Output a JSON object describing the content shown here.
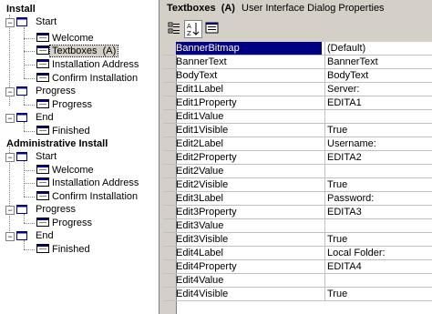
{
  "tree": {
    "install": {
      "label": "Install",
      "start": {
        "label": "Start",
        "items": [
          "Welcome",
          "Textboxes  (A)",
          "Installation Address",
          "Confirm Installation"
        ]
      },
      "progress": {
        "label": "Progress",
        "items": [
          "Progress"
        ]
      },
      "end": {
        "label": "End",
        "items": [
          "Finished"
        ]
      }
    },
    "admin": {
      "label": "Administrative Install",
      "start": {
        "label": "Start",
        "items": [
          "Welcome",
          "Installation Address",
          "Confirm Installation"
        ]
      },
      "progress": {
        "label": "Progress",
        "items": [
          "Progress"
        ]
      },
      "end": {
        "label": "End",
        "items": [
          "Finished"
        ]
      }
    }
  },
  "panel": {
    "title_bold": "Textboxes  (A)",
    "title_rest": "User Interface Dialog Properties",
    "toolbar": {
      "icons": [
        "categorized-icon",
        "alphabetical-icon",
        "property-pages-icon"
      ]
    }
  },
  "properties": [
    {
      "name": "BannerBitmap",
      "value": "(Default)"
    },
    {
      "name": "BannerText",
      "value": "BannerText"
    },
    {
      "name": "BodyText",
      "value": "BodyText"
    },
    {
      "name": "Edit1Label",
      "value": "Server:"
    },
    {
      "name": "Edit1Property",
      "value": "EDITA1"
    },
    {
      "name": "Edit1Value",
      "value": ""
    },
    {
      "name": "Edit1Visible",
      "value": "True"
    },
    {
      "name": "Edit2Label",
      "value": "Username:"
    },
    {
      "name": "Edit2Property",
      "value": "EDITA2"
    },
    {
      "name": "Edit2Value",
      "value": ""
    },
    {
      "name": "Edit2Visible",
      "value": "True"
    },
    {
      "name": "Edit3Label",
      "value": "Password:"
    },
    {
      "name": "Edit3Property",
      "value": "EDITA3"
    },
    {
      "name": "Edit3Value",
      "value": ""
    },
    {
      "name": "Edit3Visible",
      "value": "True"
    },
    {
      "name": "Edit4Label",
      "value": "Local Folder:"
    },
    {
      "name": "Edit4Property",
      "value": "EDITA4"
    },
    {
      "name": "Edit4Value",
      "value": ""
    },
    {
      "name": "Edit4Visible",
      "value": "True"
    }
  ],
  "colors": {
    "selected_row": "#000080",
    "panel_bg": "#d4d0c8"
  }
}
